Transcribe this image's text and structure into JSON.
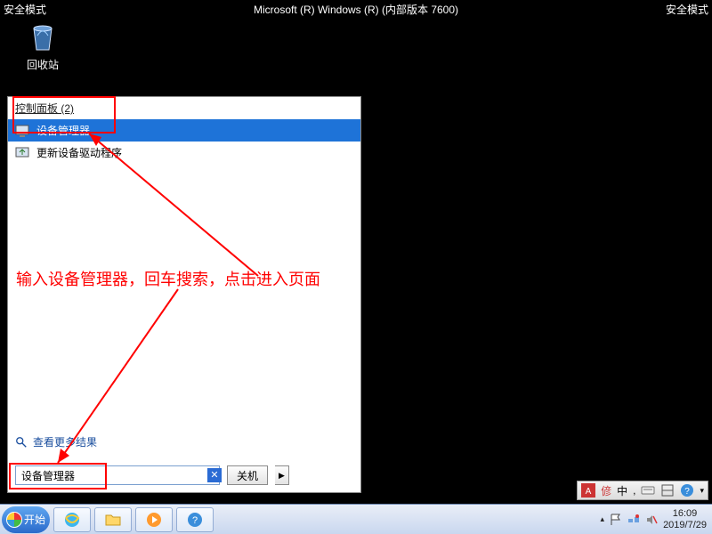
{
  "safe_mode_label": "安全模式",
  "os_title": "Microsoft (R) Windows (R) (内部版本 7600)",
  "desktop": {
    "recycle_bin": "回收站"
  },
  "start_panel": {
    "header": "控制面板 (2)",
    "results": [
      {
        "label": "设备管理器",
        "selected": true
      },
      {
        "label": "更新设备驱动程序",
        "selected": false
      }
    ],
    "see_more": "查看更多结果",
    "search_value": "设备管理器",
    "shutdown_label": "关机"
  },
  "annotation_text": "输入设备管理器，回车搜索，点击进入页面",
  "ime": {
    "lang": "中",
    "sep": ","
  },
  "taskbar": {
    "start_label": "开始",
    "time": "16:09",
    "date": "2019/7/29"
  }
}
